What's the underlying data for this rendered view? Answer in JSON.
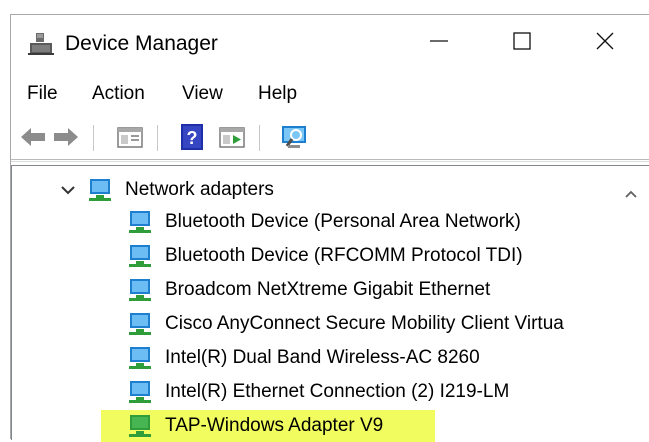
{
  "window": {
    "title": "Device Manager"
  },
  "menu": {
    "items": [
      "File",
      "Action",
      "View",
      "Help"
    ]
  },
  "toolbar": {
    "icons": [
      "back-arrow-icon",
      "forward-arrow-icon",
      "properties-pane-icon",
      "help-icon",
      "update-driver-icon",
      "scan-hardware-icon"
    ]
  },
  "tree": {
    "category": {
      "label": "Network adapters",
      "expanded": true
    },
    "devices": [
      {
        "label": "Bluetooth Device (Personal Area Network)"
      },
      {
        "label": "Bluetooth Device (RFCOMM Protocol TDI)"
      },
      {
        "label": "Broadcom NetXtreme Gigabit Ethernet"
      },
      {
        "label": "Cisco AnyConnect Secure Mobility Client Virtua"
      },
      {
        "label": "Intel(R) Dual Band Wireless-AC 8260"
      },
      {
        "label": "Intel(R) Ethernet Connection (2) I219-LM"
      },
      {
        "label": "TAP-Windows Adapter V9",
        "highlighted": true
      }
    ]
  },
  "colors": {
    "highlight": "#f1fc5e",
    "network_icon": "#1e7fd0",
    "network_icon_green": "#2f9e3a"
  }
}
